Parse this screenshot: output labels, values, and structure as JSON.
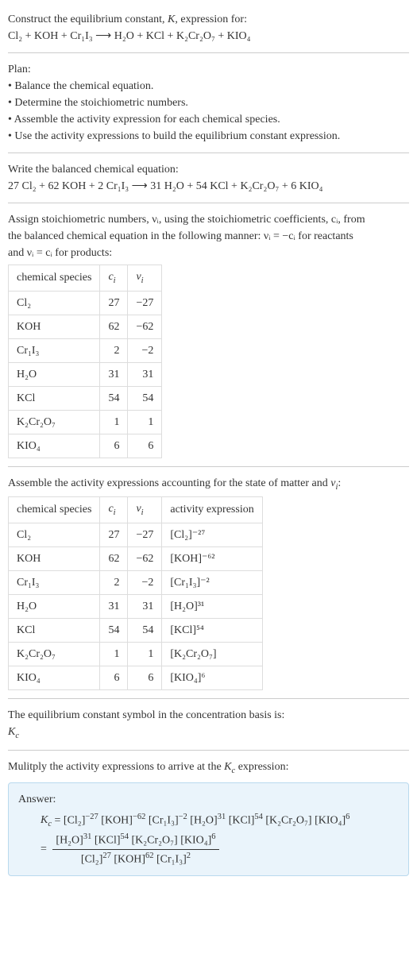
{
  "intro": {
    "line1": "Construct the equilibrium constant, K, expression for:",
    "equation": "Cl₂ + KOH + Cr₁I₃  ⟶  H₂O + KCl + K₂Cr₂O₇ + KIO₄"
  },
  "plan": {
    "heading": "Plan:",
    "items": [
      "• Balance the chemical equation.",
      "• Determine the stoichiometric numbers.",
      "• Assemble the activity expression for each chemical species.",
      "• Use the activity expressions to build the equilibrium constant expression."
    ]
  },
  "balanced": {
    "heading": "Write the balanced chemical equation:",
    "equation": "27 Cl₂ + 62 KOH + 2 Cr₁I₃  ⟶  31 H₂O + 54 KCl + K₂Cr₂O₇ + 6 KIO₄"
  },
  "assign": {
    "text_a": "Assign stoichiometric numbers, νᵢ, using the stoichiometric coefficients, cᵢ, from",
    "text_b": "the balanced chemical equation in the following manner: νᵢ = −cᵢ for reactants",
    "text_c": "and νᵢ = cᵢ for products:",
    "headers": [
      "chemical species",
      "cᵢ",
      "νᵢ"
    ],
    "rows": [
      {
        "sp": "Cl₂",
        "c": "27",
        "v": "−27"
      },
      {
        "sp": "KOH",
        "c": "62",
        "v": "−62"
      },
      {
        "sp": "Cr₁I₃",
        "c": "2",
        "v": "−2"
      },
      {
        "sp": "H₂O",
        "c": "31",
        "v": "31"
      },
      {
        "sp": "KCl",
        "c": "54",
        "v": "54"
      },
      {
        "sp": "K₂Cr₂O₇",
        "c": "1",
        "v": "1"
      },
      {
        "sp": "KIO₄",
        "c": "6",
        "v": "6"
      }
    ]
  },
  "activity": {
    "heading": "Assemble the activity expressions accounting for the state of matter and νᵢ:",
    "headers": [
      "chemical species",
      "cᵢ",
      "νᵢ",
      "activity expression"
    ],
    "rows": [
      {
        "sp": "Cl₂",
        "c": "27",
        "v": "−27",
        "a": "[Cl₂]⁻²⁷"
      },
      {
        "sp": "KOH",
        "c": "62",
        "v": "−62",
        "a": "[KOH]⁻⁶²"
      },
      {
        "sp": "Cr₁I₃",
        "c": "2",
        "v": "−2",
        "a": "[Cr₁I₃]⁻²"
      },
      {
        "sp": "H₂O",
        "c": "31",
        "v": "31",
        "a": "[H₂O]³¹"
      },
      {
        "sp": "KCl",
        "c": "54",
        "v": "54",
        "a": "[KCl]⁵⁴"
      },
      {
        "sp": "K₂Cr₂O₇",
        "c": "1",
        "v": "1",
        "a": "[K₂Cr₂O₇]"
      },
      {
        "sp": "KIO₄",
        "c": "6",
        "v": "6",
        "a": "[KIO₄]⁶"
      }
    ]
  },
  "symbol": {
    "heading": "The equilibrium constant symbol in the concentration basis is:",
    "value": "K_c"
  },
  "multiply": {
    "heading": "Mulitply the activity expressions to arrive at the K_c expression:"
  },
  "answer": {
    "label": "Answer:",
    "line1": "K_c = [Cl₂]⁻²⁷ [KOH]⁻⁶² [Cr₁I₃]⁻² [H₂O]³¹ [KCl]⁵⁴ [K₂Cr₂O₇] [KIO₄]⁶",
    "frac_num": "[H₂O]³¹ [KCl]⁵⁴ [K₂Cr₂O₇] [KIO₄]⁶",
    "frac_den": "[Cl₂]²⁷ [KOH]⁶² [Cr₁I₃]²"
  }
}
